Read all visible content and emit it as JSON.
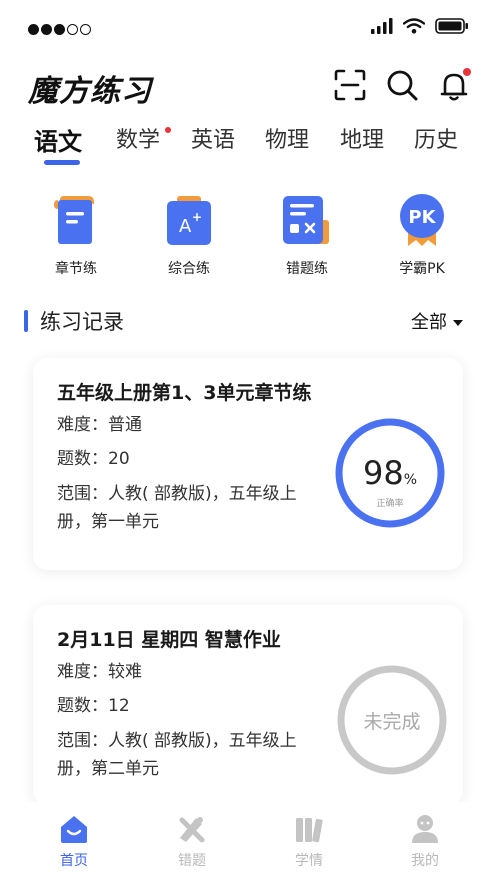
{
  "status_bar": {
    "signal_bars": 3,
    "signal_total": 5
  },
  "header": {
    "logo_text": "魔方练习"
  },
  "subjects": {
    "tabs": [
      {
        "label": "语文",
        "active": true,
        "badge": false
      },
      {
        "label": "数学",
        "active": false,
        "badge": true
      },
      {
        "label": "英语",
        "active": false,
        "badge": false
      },
      {
        "label": "物理",
        "active": false,
        "badge": false
      },
      {
        "label": "地理",
        "active": false,
        "badge": false
      },
      {
        "label": "历史",
        "active": false,
        "badge": false
      }
    ]
  },
  "features": [
    {
      "label": "章节练",
      "icon": "chapter-scroll-icon"
    },
    {
      "label": "综合练",
      "icon": "comprehensive-A-plus-icon"
    },
    {
      "label": "错题练",
      "icon": "wrong-questions-icon"
    },
    {
      "label": "学霸PK",
      "icon": "pk-badge-icon",
      "icon_text": "PK"
    }
  ],
  "records": {
    "section_title": "练习记录",
    "filter_label": "全部",
    "items": [
      {
        "title": "五年级上册第1、3单元章节练",
        "difficulty_label": "难度：",
        "difficulty": "普通",
        "count_label": "题数：",
        "count": "20",
        "range_label": "范围：",
        "range": "人教( 部教版)，五年级上册，第一单元",
        "status": "done",
        "accuracy": "98",
        "accuracy_unit": "%",
        "accuracy_caption": "正确率"
      },
      {
        "title": "2月11日 星期四 智慧作业",
        "difficulty_label": "难度：",
        "difficulty": "较难",
        "count_label": "题数：",
        "count": "12",
        "range_label": "范围：",
        "range": "人教( 部教版)，五年级上册，第二单元",
        "status": "undone",
        "status_text": "未完成"
      }
    ]
  },
  "bottom_nav": [
    {
      "label": "首页",
      "icon": "home-icon",
      "active": true
    },
    {
      "label": "错题",
      "icon": "wrong-book-icon",
      "active": false
    },
    {
      "label": "学情",
      "icon": "learning-stats-icon",
      "active": false
    },
    {
      "label": "我的",
      "icon": "profile-icon",
      "active": false
    }
  ],
  "colors": {
    "accent": "#3c64e6",
    "badge": "#e8333a",
    "inactive": "#b9b9b9",
    "ring_done": "#4a72f0",
    "ring_undone": "#c8c8c8"
  }
}
